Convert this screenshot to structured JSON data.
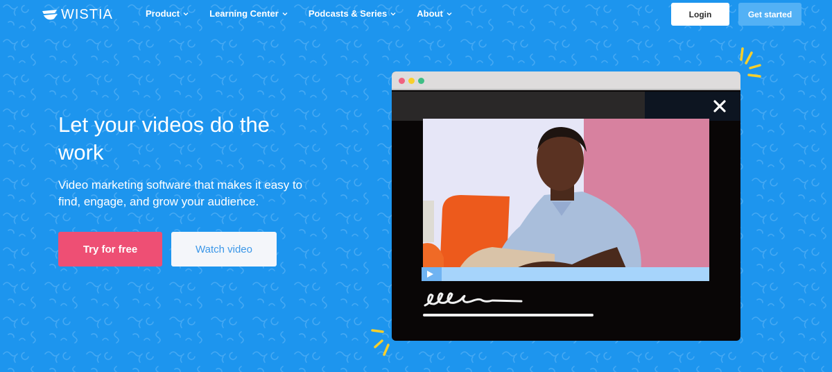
{
  "brand": {
    "name": "WISTIA",
    "colors": {
      "background": "#1d95ee",
      "primary_cta": "#ee4f74",
      "secondary_cta_text": "#3b97e8",
      "get_started": "#53b1f5",
      "accent_spark": "#f8cf2b"
    }
  },
  "nav": {
    "menu": [
      {
        "label": "Product",
        "icon": "chevron-down-icon"
      },
      {
        "label": "Learning Center",
        "icon": "chevron-down-icon"
      },
      {
        "label": "Podcasts & Series",
        "icon": "chevron-down-icon"
      },
      {
        "label": "About",
        "icon": "chevron-down-icon"
      }
    ],
    "login_label": "Login",
    "get_started_label": "Get started"
  },
  "hero": {
    "title": "Let your videos do the work",
    "subtitle": "Video marketing software that makes it easy to find, engage, and grow your audience.",
    "try_label": "Try for free",
    "watch_label": "Watch video"
  },
  "video_mock": {
    "window_dots": [
      "red",
      "yellow",
      "green"
    ],
    "close_icon": "close-icon",
    "play_icon": "play-icon",
    "progress": 0.07,
    "signature_text": "ellen"
  }
}
